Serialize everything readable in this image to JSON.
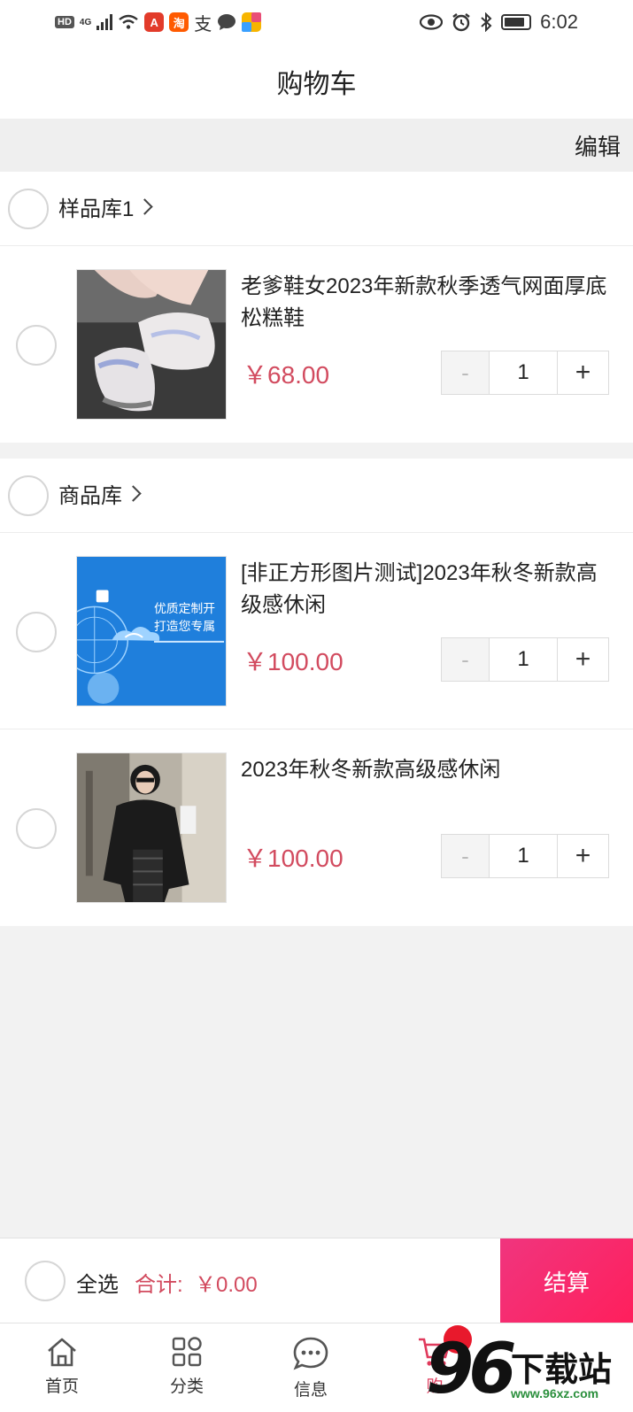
{
  "status_bar": {
    "left_badges": [
      "HD",
      "4G"
    ],
    "app_icons": [
      {
        "name": "a-app-icon",
        "glyph": "A",
        "color": "#e23b2a"
      },
      {
        "name": "taobao-icon",
        "glyph": "淘",
        "color": "#ff5a00"
      }
    ],
    "alipay_glyph": "支",
    "time": "6:02"
  },
  "header": {
    "title": "购物车"
  },
  "edit_label": "编辑",
  "groups": [
    {
      "name": "样品库1",
      "items": [
        {
          "title": "老爹鞋女2023年新款秋季透气网面厚底松糕鞋",
          "price": "￥68.00",
          "qty": "1",
          "image": "sneaker-photo"
        }
      ]
    },
    {
      "name": "商品库",
      "items": [
        {
          "title": "[非正方形图片测试]2023年秋冬新款高级感休闲",
          "price": "￥100.00",
          "qty": "1",
          "image": "banner-image",
          "image_text_1": "优质定制开",
          "image_text_2": "打造您专属"
        },
        {
          "title": "2023年秋冬新款高级感休闲",
          "price": "￥100.00",
          "qty": "1",
          "image": "fashion-photo"
        }
      ]
    }
  ],
  "stepper": {
    "minus": "-",
    "plus": "+"
  },
  "footer": {
    "select_all": "全选",
    "total_label": "合计:",
    "total_value": "￥0.00",
    "checkout": "结算"
  },
  "tabbar": {
    "tabs": [
      {
        "label": "首页"
      },
      {
        "label": "分类"
      },
      {
        "label": "信息"
      },
      {
        "label": "购"
      }
    ]
  },
  "watermark": {
    "number": "96",
    "text": "下载站",
    "url": "www.96xz.com"
  },
  "colors": {
    "accent": "#d24b5f",
    "checkout_start": "#f0357e",
    "checkout_end": "#ff1f5c"
  }
}
